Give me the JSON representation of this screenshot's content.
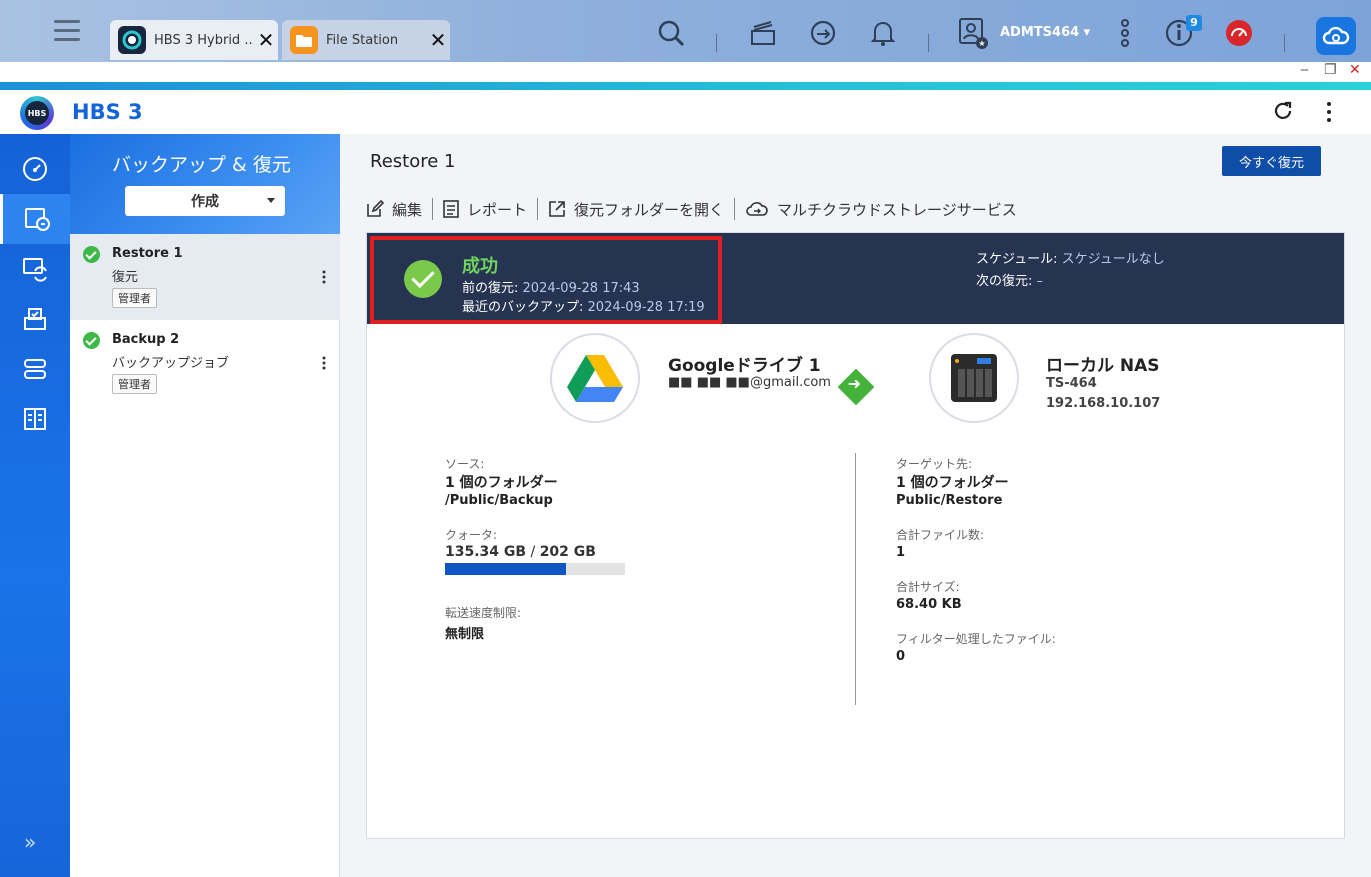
{
  "taskbar": {
    "tabs": [
      {
        "label": "HBS 3 Hybrid ...",
        "active": true
      },
      {
        "label": "File Station",
        "active": false
      }
    ],
    "user": "ADMTS464",
    "notification_count": "9"
  },
  "app": {
    "title": "HBS 3",
    "logo_text": "HBS"
  },
  "sidebar": {
    "items": [
      {
        "name": "overview",
        "active": false
      },
      {
        "name": "backup-restore",
        "active": true
      },
      {
        "name": "sync",
        "active": false
      },
      {
        "name": "storage",
        "active": false
      },
      {
        "name": "services",
        "active": false
      },
      {
        "name": "logs",
        "active": false
      }
    ],
    "more": "»"
  },
  "jobs_panel": {
    "title": "バックアップ & 復元",
    "create_label": "作成",
    "jobs": [
      {
        "name": "Restore 1",
        "type": "復元",
        "role": "管理者",
        "selected": true
      },
      {
        "name": "Backup 2",
        "type": "バックアップジョブ",
        "role": "管理者",
        "selected": false
      }
    ]
  },
  "main": {
    "title": "Restore 1",
    "restore_now": "今すぐ復元",
    "toolbar": {
      "edit": "編集",
      "report": "レポート",
      "open_folder": "復元フォルダーを開く",
      "multicloud": "マルチクラウドストレージサービス"
    },
    "status": {
      "title": "成功",
      "last_restore_label": "前の復元:",
      "last_restore_value": "2024-09-28 17:43",
      "last_backup_label": "最近のバックアップ:",
      "last_backup_value": "2024-09-28 17:19",
      "schedule_label": "スケジュール:",
      "schedule_value": "スケジュールなし",
      "next_label": "次の復元:",
      "next_value": "–"
    },
    "source": {
      "name": "Googleドライブ 1",
      "account": "■■ ■■ ■■@gmail.com",
      "label": "ソース:",
      "folders": "1 個のフォルダー",
      "path": "/Public/Backup",
      "quota_label": "クォータ:",
      "quota_used": "135.34 GB",
      "quota_sep": " / ",
      "quota_total": "202 GB",
      "quota_fraction": 0.67,
      "speed_label": "転送速度制限:",
      "speed_value": "無制限"
    },
    "target": {
      "name": "ローカル NAS",
      "model": "TS-464",
      "ip": "192.168.10.107",
      "label": "ターゲット先:",
      "folders": "1 個のフォルダー",
      "path": "Public/Restore",
      "files_label": "合計ファイル数:",
      "files_value": "1",
      "size_label": "合計サイズ:",
      "size_value": "68.40 KB",
      "filtered_label": "フィルター処理したファイル:",
      "filtered_value": "0"
    }
  },
  "colors": {
    "accent": "#1565d8",
    "status_bg": "#263451",
    "success": "#6ed35c",
    "highlight": "#e0201f"
  }
}
